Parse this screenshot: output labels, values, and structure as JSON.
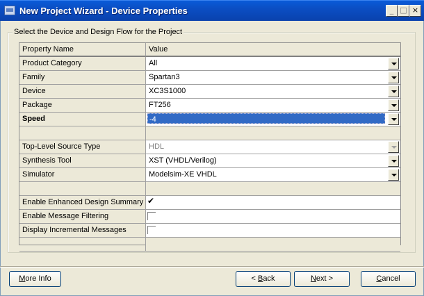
{
  "window": {
    "title": "New Project Wizard - Device Properties",
    "controls": {
      "minimize": "_",
      "maximize": "□",
      "close": "×"
    }
  },
  "group": {
    "legend": "Select the Device and Design Flow for the Project"
  },
  "grid": {
    "header": {
      "name": "Property Name",
      "value": "Value"
    },
    "rows": [
      {
        "name": "Product Category",
        "value": "All",
        "kind": "combo"
      },
      {
        "name": "Family",
        "value": "Spartan3",
        "kind": "combo"
      },
      {
        "name": "Device",
        "value": "XC3S1000",
        "kind": "combo"
      },
      {
        "name": "Package",
        "value": "FT256",
        "kind": "combo"
      },
      {
        "name": "Speed",
        "value": "-4",
        "kind": "combo",
        "bold": true,
        "selected": true
      },
      {
        "name": "",
        "value": "",
        "kind": "blank"
      },
      {
        "name": "Top-Level Source Type",
        "value": "HDL",
        "kind": "combo",
        "disabled": true
      },
      {
        "name": "Synthesis Tool",
        "value": "XST (VHDL/Verilog)",
        "kind": "combo"
      },
      {
        "name": "Simulator",
        "value": "Modelsim-XE VHDL",
        "kind": "combo"
      },
      {
        "name": "",
        "value": "",
        "kind": "blank"
      },
      {
        "name": "Enable Enhanced Design Summary",
        "value": true,
        "kind": "check"
      },
      {
        "name": "Enable Message Filtering",
        "value": false,
        "kind": "check"
      },
      {
        "name": "Display Incremental Messages",
        "value": false,
        "kind": "check"
      },
      {
        "name": "",
        "value": "",
        "kind": "blank"
      }
    ]
  },
  "buttons": {
    "more_info": {
      "mn": "M",
      "rest": "ore Info"
    },
    "back": {
      "pre": "< ",
      "mn": "B",
      "rest": "ack"
    },
    "next": {
      "mn": "N",
      "rest": "ext >"
    },
    "cancel": {
      "mn": "C",
      "rest": "ancel"
    }
  }
}
